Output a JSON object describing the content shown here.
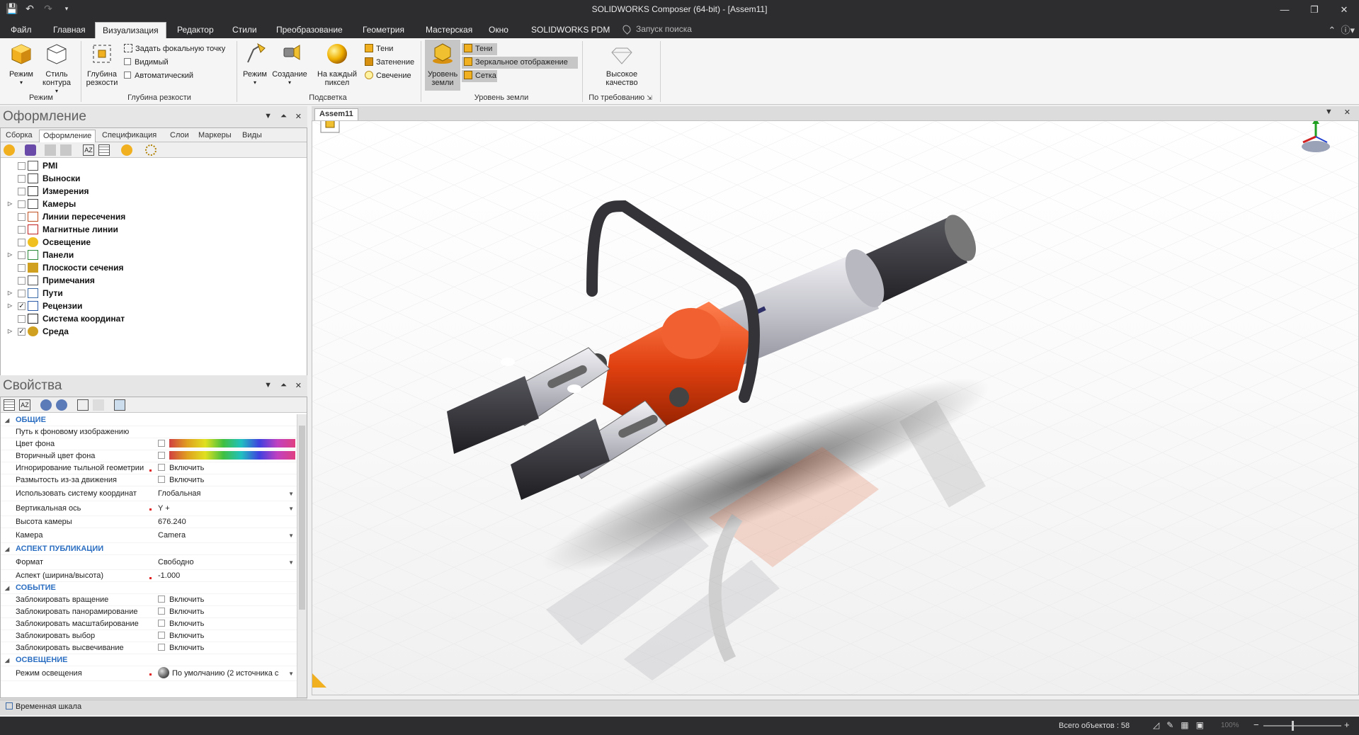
{
  "window": {
    "title": "SOLIDWORKS Composer (64-bit) - [Assem11]"
  },
  "menu": {
    "tabs": [
      {
        "label": "Файл",
        "active": false
      },
      {
        "label": "Главная",
        "active": false
      },
      {
        "label": "Визуализация",
        "active": true
      },
      {
        "label": "Редактор",
        "active": false
      },
      {
        "label": "Стили",
        "active": false
      },
      {
        "label": "Преобразование",
        "active": false
      },
      {
        "label": "Геометрия",
        "active": false
      },
      {
        "label": "Мастерская",
        "active": false
      },
      {
        "label": "Окно",
        "active": false
      },
      {
        "label": "SOLIDWORKS PDM",
        "active": false
      }
    ],
    "search_placeholder": "Запуск поиска"
  },
  "ribbon": {
    "mode": {
      "mode_label": "Режим",
      "style_label": "Стиль контура",
      "group": "Режим"
    },
    "dof": {
      "depth_label": "Глубина резкости",
      "focal_label": "Задать фокальную точку",
      "visible_label": "Видимый",
      "auto_label": "Автоматический",
      "group": "Глубина резкости"
    },
    "lighting": {
      "mode_label": "Режим",
      "create_label": "Создание",
      "perpixel_label": "На каждый пиксел",
      "shadows_label": "Тени",
      "shading_label": "Затенение",
      "glow_label": "Свечение",
      "group": "Подсветка"
    },
    "ground": {
      "level_label": "Уровень земли",
      "shadows_label": "Тени",
      "mirror_label": "Зеркальное отображение",
      "grid_label": "Сетка",
      "group": "Уровень земли"
    },
    "demand": {
      "hq_label": "Высокое качество",
      "group": "По требованию"
    }
  },
  "design_panel": {
    "title": "Оформление",
    "tabs": [
      {
        "label": "Сборка",
        "active": false
      },
      {
        "label": "Оформление",
        "active": true
      },
      {
        "label": "Спецификация",
        "active": false
      },
      {
        "label": "Слои",
        "active": false
      },
      {
        "label": "Маркеры",
        "active": false
      },
      {
        "label": "Виды",
        "active": false
      }
    ],
    "tree": [
      {
        "label": "PMI",
        "expandable": false,
        "checked": false,
        "icon": "pmi-icon"
      },
      {
        "label": "Выноски",
        "expandable": false,
        "checked": false,
        "icon": "callout-icon"
      },
      {
        "label": "Измерения",
        "expandable": false,
        "checked": false,
        "icon": "measure-icon"
      },
      {
        "label": "Камеры",
        "expandable": true,
        "checked": false,
        "icon": "camera-icon"
      },
      {
        "label": "Линии пересечения",
        "expandable": false,
        "checked": false,
        "icon": "intersection-icon"
      },
      {
        "label": "Магнитные линии",
        "expandable": false,
        "checked": false,
        "icon": "magnet-icon"
      },
      {
        "label": "Освещение",
        "expandable": false,
        "checked": false,
        "icon": "light-icon"
      },
      {
        "label": "Панели",
        "expandable": true,
        "checked": false,
        "icon": "panel-icon"
      },
      {
        "label": "Плоскости сечения",
        "expandable": false,
        "checked": false,
        "icon": "cut-plane-icon"
      },
      {
        "label": "Примечания",
        "expandable": false,
        "checked": false,
        "icon": "note-icon"
      },
      {
        "label": "Пути",
        "expandable": true,
        "checked": false,
        "icon": "path-icon"
      },
      {
        "label": "Рецензии",
        "expandable": true,
        "checked": true,
        "icon": "review-icon"
      },
      {
        "label": "Система координат",
        "expandable": false,
        "checked": false,
        "icon": "axes-icon"
      },
      {
        "label": "Среда",
        "expandable": true,
        "checked": true,
        "icon": "environment-icon"
      }
    ]
  },
  "props_panel": {
    "title": "Свойства",
    "rows": [
      {
        "type": "section",
        "label": "ОБЩИЕ"
      },
      {
        "type": "prop",
        "label": "Путь к фоновому изображению",
        "value": "",
        "kind": "text"
      },
      {
        "type": "prop",
        "label": "Цвет фона",
        "value": "",
        "kind": "color"
      },
      {
        "type": "prop",
        "label": "Вторичный цвет фона",
        "value": "",
        "kind": "color"
      },
      {
        "type": "prop",
        "label": "Игнорирование тыльной геометрии",
        "value": "Включить",
        "kind": "check",
        "mark": true
      },
      {
        "type": "prop",
        "label": "Размытость из-за движения",
        "value": "Включить",
        "kind": "check"
      },
      {
        "type": "prop",
        "label": "Использовать систему координат",
        "value": "Глобальная",
        "kind": "dropdown",
        "tall": true
      },
      {
        "type": "prop",
        "label": "Вертикальная ось",
        "value": "Y +",
        "kind": "dropdown",
        "mark": true,
        "tall": true
      },
      {
        "type": "prop",
        "label": "Высота камеры",
        "value": "676.240",
        "kind": "text"
      },
      {
        "type": "prop",
        "label": "Камера",
        "value": "Camera",
        "kind": "dropdown",
        "tall": true
      },
      {
        "type": "section",
        "label": "АСПЕКТ ПУБЛИКАЦИИ"
      },
      {
        "type": "prop",
        "label": "Формат",
        "value": "Свободно",
        "kind": "dropdown",
        "tall": true
      },
      {
        "type": "prop",
        "label": "Аспект (ширина/высота)",
        "value": "-1.000",
        "kind": "text",
        "mark": true
      },
      {
        "type": "section",
        "label": "СОБЫТИЕ"
      },
      {
        "type": "prop",
        "label": "Заблокировать вращение",
        "value": "Включить",
        "kind": "check"
      },
      {
        "type": "prop",
        "label": "Заблокировать панорамирование",
        "value": "Включить",
        "kind": "check"
      },
      {
        "type": "prop",
        "label": "Заблокировать масштабирование",
        "value": "Включить",
        "kind": "check"
      },
      {
        "type": "prop",
        "label": "Заблокировать выбор",
        "value": "Включить",
        "kind": "check"
      },
      {
        "type": "prop",
        "label": "Заблокировать высвечивание",
        "value": "Включить",
        "kind": "check"
      },
      {
        "type": "section",
        "label": "ОСВЕЩЕНИЕ"
      },
      {
        "type": "prop",
        "label": "Режим освещения",
        "value": "По умолчанию (2 источника с",
        "kind": "sphere",
        "mark": true,
        "tall": true
      }
    ]
  },
  "viewport": {
    "tab_label": "Assem11",
    "colors": {
      "accent": "#e04010",
      "tool_dark": "#2b2b30",
      "tool_silver": "#c9c9d2",
      "handle": "#444448"
    }
  },
  "timeline": {
    "label": "Временная шкала"
  },
  "status": {
    "count": "Всего объектов : 58",
    "zoom": "100%"
  }
}
